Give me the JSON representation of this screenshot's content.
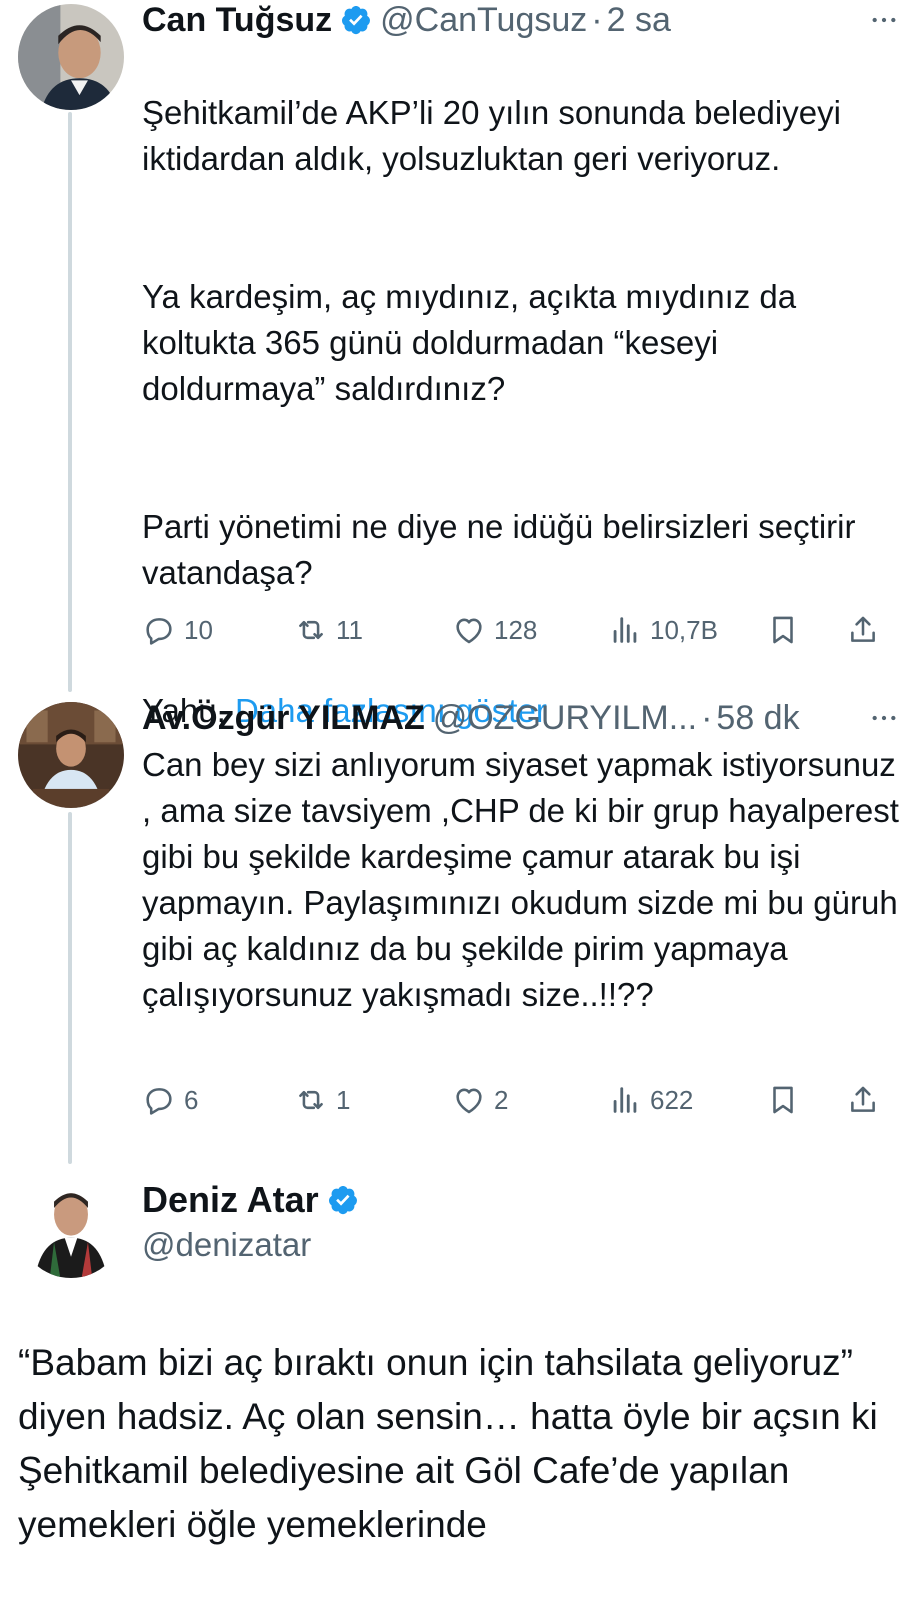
{
  "tweets": [
    {
      "name": "Can Tuğsuz",
      "verified": true,
      "handle": "@CanTugsuz",
      "separator": "·",
      "time": "2 sa",
      "paragraphs": [
        "Şehitkamil’de AKP’li 20 yılın sonunda belediyeyi iktidardan aldık, yolsuzluktan geri veriyoruz.",
        "Ya kardeşim, aç mıydınız, açıkta mıydınız da koltukta 365 günü doldurmadan “keseyi doldurmaya”  saldırdınız?",
        "Parti yönetimi ne diye ne idüğü belirsizleri seçtirir vatandaşa?"
      ],
      "last_line": "Yahu,",
      "show_more": "Daha fazlasını göster",
      "replies": "10",
      "retweets": "11",
      "likes": "128",
      "views": "10,7B"
    },
    {
      "name": "Av.Özgür YILMAZ",
      "verified": false,
      "handle": "@OZGURYILM...",
      "separator": "·",
      "time": "58 dk",
      "text": "Can bey sizi anlıyorum siyaset yapmak istiyorsunuz , ama size tavsiyem ,CHP de ki bir grup hayalperest gibi bu şekilde kardeşime  çamur atarak bu işi yapmayın. Paylaşımınızı okudum sizde mi bu güruh gibi aç kaldınız da bu şekilde pirim yapmaya çalışıyorsunuz yakışmadı size..!!??",
      "replies": "6",
      "retweets": "1",
      "likes": "2",
      "views": "622"
    }
  ],
  "main": {
    "name": "Deniz Atar",
    "verified": true,
    "handle": "@denizatar",
    "text": "“Babam bizi aç bıraktı onun için tahsilata geliyoruz” diyen hadsiz. Aç olan sensin… hatta öyle bir açsın ki Şehitkamil belediyesine ait Göl Cafe’de yapılan yemekleri öğle yemeklerinde"
  },
  "colors": {
    "text": "#0f1419",
    "secondary": "#536471",
    "link": "#1d9bf0",
    "thread_line": "#cfd9de",
    "verified": "#1d9bf0"
  },
  "icons": [
    "verified-badge-icon",
    "more-icon",
    "reply-icon",
    "retweet-icon",
    "like-icon",
    "views-icon",
    "bookmark-icon",
    "share-icon"
  ]
}
